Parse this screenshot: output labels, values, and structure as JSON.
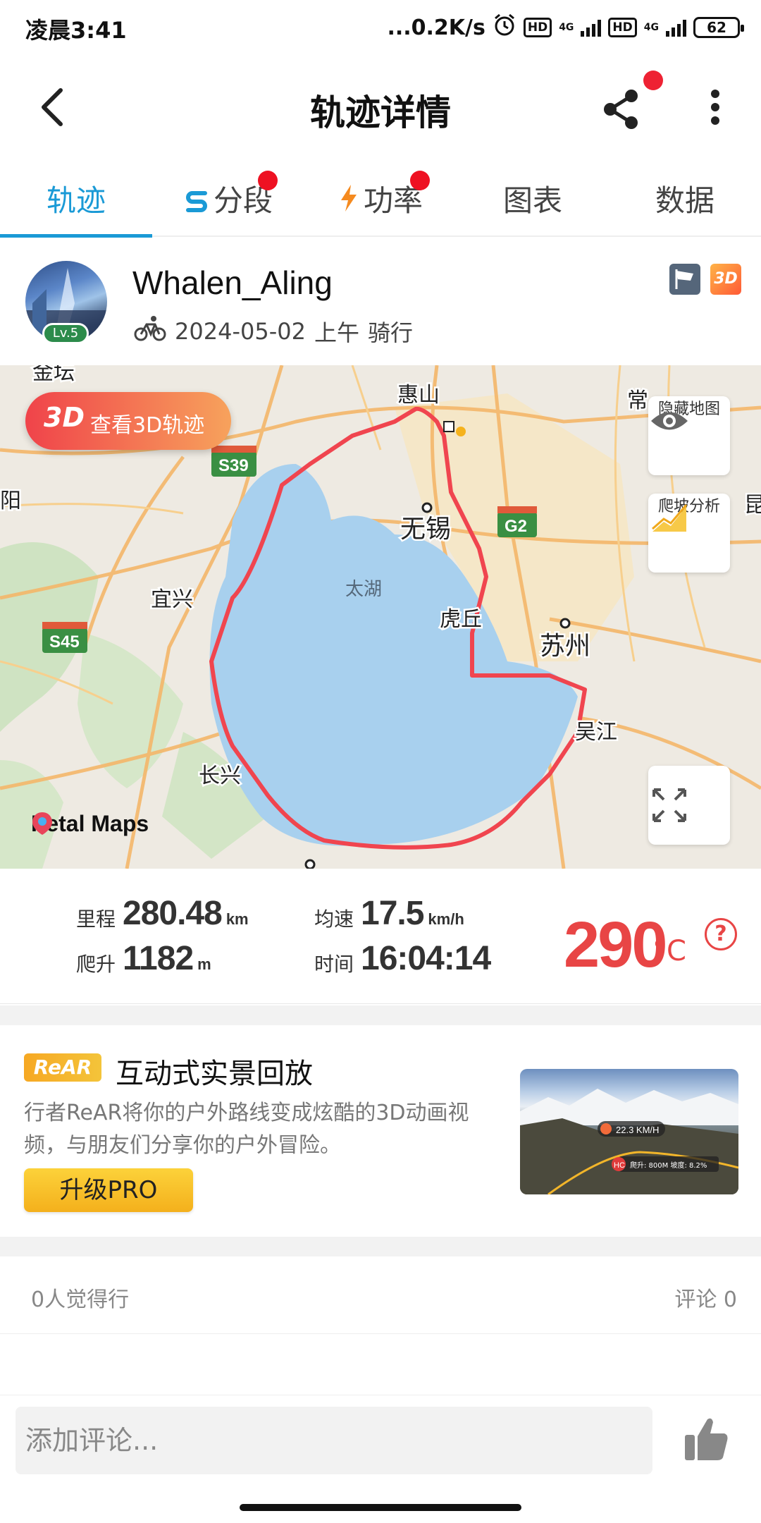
{
  "status_bar": {
    "time": "凌晨3:41",
    "network_speed": "...0.2K/s",
    "hd1": "HD",
    "net1": "4G",
    "hd2": "HD",
    "net2": "4G",
    "battery": "62"
  },
  "header": {
    "title": "轨迹详情"
  },
  "tabs": [
    {
      "label": "轨迹",
      "active": true
    },
    {
      "label": "分段",
      "dot": true
    },
    {
      "label": "功率",
      "dot": true
    },
    {
      "label": "图表"
    },
    {
      "label": "数据"
    }
  ],
  "profile": {
    "username": "Whalen_Aling",
    "level": "Lv.5",
    "date": "2024-05-02",
    "period": "上午",
    "activity": "骑行",
    "badge_3d": "3D"
  },
  "map": {
    "view_3d_tag": "3D",
    "view_3d_label": "查看3D轨迹",
    "hide_map_label": "隐藏地图",
    "climb_label": "爬坡分析",
    "provider": "Petal Maps",
    "place_labels": [
      "金坛",
      "惠山",
      "常",
      "阳",
      "无锡",
      "宜兴",
      "虎丘",
      "苏州",
      "太湖",
      "吴江",
      "长兴",
      "昆"
    ],
    "road_labels": [
      "S39",
      "G2",
      "S45"
    ],
    "route_color": "#f0454f",
    "lake_color": "#a8d0ee"
  },
  "stats": {
    "distance_label": "里程",
    "distance_value": "280.48",
    "distance_unit": "km",
    "speed_label": "均速",
    "speed_value": "17.5",
    "speed_unit": "km/h",
    "climb_label": "爬升",
    "climb_value": "1182",
    "climb_unit": "m",
    "time_label": "时间",
    "time_value": "16:04:14",
    "temperature_value": "290",
    "temperature_unit": "°C",
    "help": "?"
  },
  "promo": {
    "logo": "ReAR",
    "title": "互动式实景回放",
    "description": "行者ReAR将你的户外路线变成炫酷的3D动画视频，与朋友们分享你的户外冒险。",
    "button": "升级PRO",
    "image_speed": "22.3 KM/H",
    "image_tag": "HC",
    "image_info": "爬升: 800M  坡度: 8.2%"
  },
  "social": {
    "likes": "0人觉得行",
    "comments": "评论 0"
  },
  "comment_box": {
    "placeholder": "添加评论..."
  }
}
